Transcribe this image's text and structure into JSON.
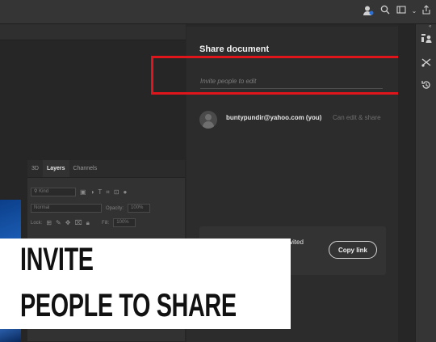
{
  "topbar": {
    "icons": [
      "share-user-icon",
      "search-icon",
      "workspace-icon",
      "chevron-down-icon",
      "export-icon"
    ]
  },
  "layers_panel": {
    "tabs": [
      "3D",
      "Layers",
      "Channels"
    ],
    "active_tab": "Layers",
    "kind_filter": "Kind",
    "blend_mode": "Normal",
    "opacity_label": "Opacity:",
    "opacity_value": "100%",
    "lock_label": "Lock:",
    "fill_label": "Fill:",
    "fill_value": "100%"
  },
  "share": {
    "title": "Share document",
    "invite_placeholder": "Invite people to edit",
    "user_email": "buntypundir@yahoo.com (you)",
    "user_permission": "Can edit & share",
    "invited_text": "vited",
    "copy_link_label": "Copy link",
    "highlight_color": "#e0141b"
  },
  "right_strip": {
    "icons": [
      "properties-icon",
      "adjustments-icon",
      "history-icon"
    ]
  },
  "overlay": {
    "line1": "INVITE",
    "line2": "PEOPLE TO SHARE"
  }
}
